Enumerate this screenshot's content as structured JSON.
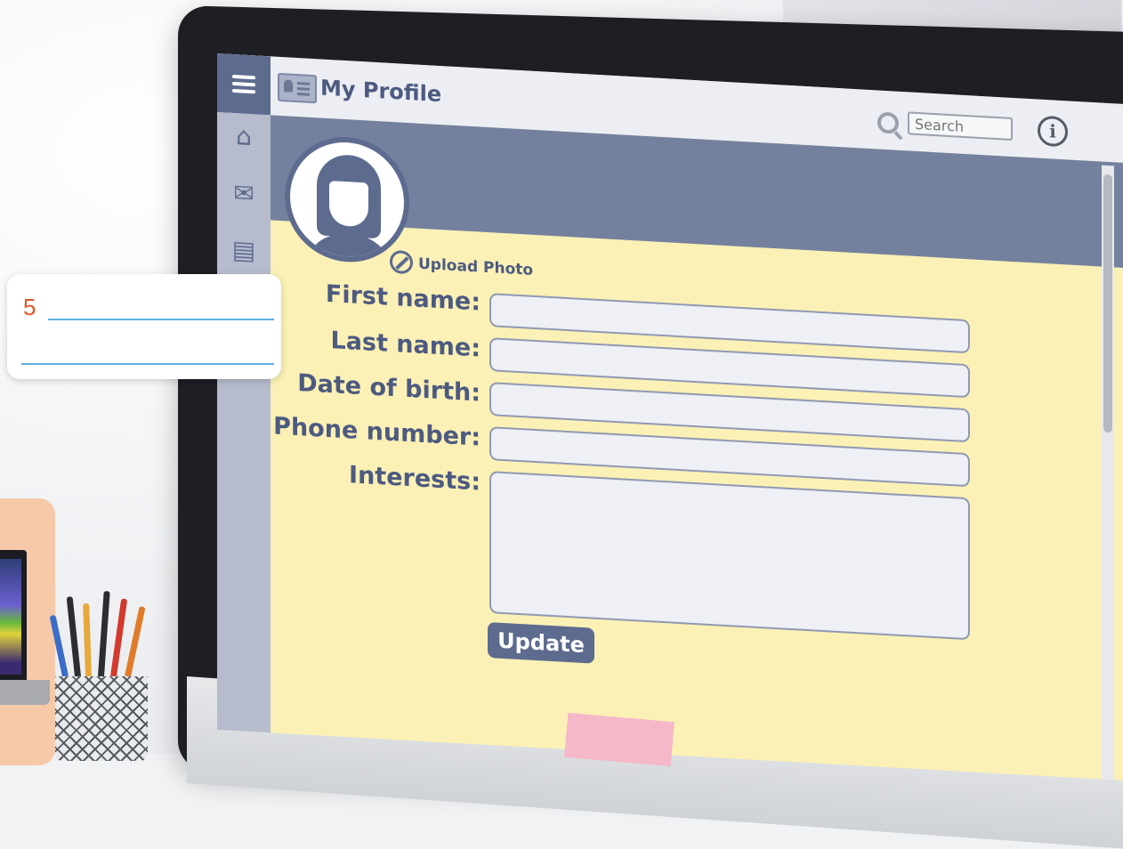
{
  "app": {
    "title": "My Profile"
  },
  "header": {
    "search_placeholder": "Search"
  },
  "profile": {
    "upload_label": "Upload Photo"
  },
  "form": {
    "fields": [
      {
        "label": "First name:",
        "value": ""
      },
      {
        "label": "Last name:",
        "value": ""
      },
      {
        "label": "Date of birth:",
        "value": ""
      },
      {
        "label": "Phone number:",
        "value": ""
      },
      {
        "label": "Interests:",
        "value": ""
      }
    ],
    "submit_label": "Update"
  },
  "sidebar": {
    "icons": [
      "home-icon",
      "mail-icon",
      "document-icon"
    ]
  },
  "worksheet": {
    "number": "5"
  },
  "colors": {
    "accent": "#5d6b8f",
    "form_background": "#fbf1b6",
    "banner": "#74819e",
    "sidebar": "#b6bccd",
    "number": "#e0562c",
    "answer_line": "#5fb1e0"
  }
}
